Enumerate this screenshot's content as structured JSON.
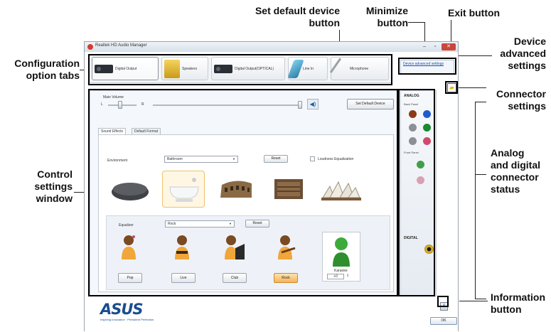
{
  "annotations": {
    "set_default_device_button": "Set default device\nbutton",
    "minimize_button": "Minimize\nbutton",
    "exit_button": "Exit button",
    "device_advanced_settings": "Device\nadvanced\nsettings",
    "configuration_option_tabs": "Configuration\noption tabs",
    "connector_settings": "Connector\nsettings",
    "analog_digital_status": "Analog\nand digital\nconnector\nstatus",
    "control_settings_window": "Control\nsettings\nwindow",
    "information_button": "Information\nbutton"
  },
  "window": {
    "title": "Realtek HD Audio Manager",
    "minimize_glyph": "–",
    "maximize_glyph": "▫",
    "close_glyph": "✕"
  },
  "tabs": [
    {
      "label": "Digital Output",
      "icon": "speaker-icon"
    },
    {
      "label": "Speakers",
      "icon": "speakers-icon"
    },
    {
      "label": "Digital Output(OPTICAL)",
      "icon": "speaker-icon"
    },
    {
      "label": "Line In",
      "icon": "line-in-icon"
    },
    {
      "label": "Microphone",
      "icon": "microphone-icon"
    }
  ],
  "device_advanced_link": "Device advanced settings",
  "main_volume": {
    "label": "Main Volume",
    "left": "L",
    "right": "R",
    "balance": 0.5,
    "volume": 1.0
  },
  "set_default_button": "Set Default Device",
  "sub_tabs": [
    "Sound Effects",
    "Default Format"
  ],
  "environment": {
    "label": "Environment",
    "value": "Bathroom",
    "reset": "Reset",
    "loudness": "Loudness Equalization"
  },
  "equalizer": {
    "label": "Equalizer",
    "value": "Rock",
    "reset": "Reset",
    "presets": [
      "Pop",
      "Live",
      "Club",
      "Rock"
    ],
    "active_preset": "Rock"
  },
  "karaoke": {
    "label": "Karaoke",
    "value": "+0"
  },
  "connectors": {
    "analog_label": "ANALOG",
    "back_panel": "Back Panel",
    "front_panel": "Front Panel",
    "digital_label": "DIGITAL",
    "back_jacks": [
      "#8a3b14",
      "#1e5bd0",
      "#8c8f94",
      "#1b8a2e",
      "#8c8f94",
      "#d14a6a"
    ],
    "front_jacks": [
      "#3f9f4a",
      "#d9a0b2"
    ]
  },
  "footer": {
    "logo": "ASUS",
    "tagline": "Inspiring Innovation · Persistent Perfection",
    "info_glyph": "i",
    "ok": "OK"
  }
}
